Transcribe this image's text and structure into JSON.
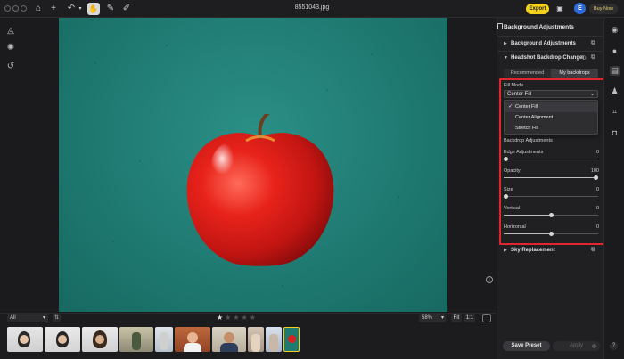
{
  "window": {
    "filename": "8551043.jpg"
  },
  "topbar": {
    "export_label": "Export",
    "account_initial": "E",
    "buy_label": "Buy Now"
  },
  "panel": {
    "title": "Background Adjustments",
    "sections": {
      "background_adjustments": "Background Adjustments",
      "headshot_backdrop": "Headshot Backdrop Changer",
      "sky_replacement": "Sky Replacement"
    },
    "tabs": [
      "Recommended",
      "My backdrops"
    ],
    "active_tab": "My backdrops",
    "fill_mode": {
      "label": "Fill Mode",
      "selected": "Center Fill",
      "options": [
        "Center Fill",
        "Center Alignment",
        "Stretch Fill"
      ]
    },
    "backdrop_adjustments_label": "Backdrop Adjustments",
    "sliders": [
      {
        "label": "Edge Adjustments",
        "value": "0",
        "fraction": 0.0
      },
      {
        "label": "Opacity",
        "value": "100",
        "fraction": 1.0
      },
      {
        "label": "Size",
        "value": "0",
        "fraction": 0.0
      },
      {
        "label": "Vertical",
        "value": "0",
        "fraction": 0.5
      },
      {
        "label": "Horizontal",
        "value": "0",
        "fraction": 0.5
      }
    ],
    "save_preset_label": "Save Preset",
    "apply_label": "Apply"
  },
  "filmstrip": {
    "filter_label": "All",
    "rating": 1,
    "zoom": "58%",
    "fit_label": "Fit",
    "one_label": "1:1",
    "thumbnail_count": 10
  },
  "colors": {
    "accent_yellow": "#f5d21a",
    "highlight_red": "#e0262f",
    "background_teal": "#1f7a72",
    "avatar_blue": "#2f6bd8"
  },
  "icons": {
    "left_tools": [
      "triangle-adjust-icon",
      "sun-gear-icon",
      "history-icon"
    ],
    "right_rail": [
      "eye-icon",
      "mask-icon",
      "panel-icon",
      "shirt-icon",
      "face-frame-icon",
      "camera-icon"
    ]
  }
}
